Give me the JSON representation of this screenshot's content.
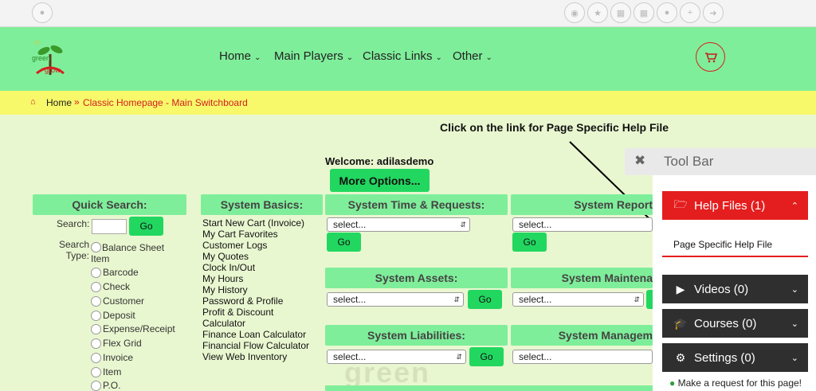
{
  "topbar": {
    "left_icon": "water-drop-icon",
    "right_icons": [
      "dashboard-icon",
      "star-icon",
      "building-icon",
      "calendar-icon",
      "user-icon",
      "add-user-icon",
      "sign-out-icon"
    ]
  },
  "nav": {
    "logo_text_1": "green",
    "logo_text_2": "grow",
    "items": [
      {
        "label": "Home"
      },
      {
        "label": "Main Players"
      },
      {
        "label": "Classic Links"
      },
      {
        "label": "Other"
      }
    ],
    "cart_icon": "shopping-cart-icon"
  },
  "breadcrumb": {
    "home": "Home",
    "separator": "»",
    "current": "Classic Homepage - Main Switchboard"
  },
  "help_caption": "Click on the link for Page Specific Help File",
  "welcome": "Welcome: adilasdemo",
  "more_options": "More Options...",
  "quick_search": {
    "title": "Quick Search:",
    "search_label": "Search:",
    "search_value": "",
    "go": "Go",
    "type_label": "Search Type:",
    "types": [
      "Balance Sheet Item",
      "Barcode",
      "Check",
      "Customer",
      "Deposit",
      "Expense/Receipt",
      "Flex Grid",
      "Invoice",
      "Item",
      "P.O."
    ]
  },
  "system_basics": {
    "title": "System Basics:",
    "links": [
      "Start New Cart (Invoice)",
      "My Cart Favorites",
      "Customer Logs",
      "My Quotes",
      "Clock In/Out",
      "My Hours",
      "My History",
      "Password & Profile",
      "Profit & Discount",
      "Calculator",
      "Finance Loan Calculator",
      "Financial Flow Calculator",
      "View Web Inventory"
    ]
  },
  "sections": {
    "time": {
      "title": "System Time & Requests:",
      "select": "select...",
      "go": "Go"
    },
    "reports": {
      "title": "System Report",
      "select": "select...",
      "go": "Go"
    },
    "assets": {
      "title": "System Assets:",
      "select": "select...",
      "go": "Go"
    },
    "maintenance": {
      "title": "System Maintena",
      "select": "select...",
      "go": "Go"
    },
    "liabilities": {
      "title": "System Liabilities:",
      "select": "select...",
      "go": "Go"
    },
    "management": {
      "title": "System Managem",
      "select": "select..."
    }
  },
  "toolbar": {
    "title": "Tool Bar",
    "help_files": "Help Files (1)",
    "page_help": "Page Specific Help File",
    "videos": "Videos (0)",
    "courses": "Courses (0)",
    "settings": "Settings (0)",
    "request": "Make a request for this page!"
  },
  "colors": {
    "nav_green": "#7fee9a",
    "button_green": "#22d760",
    "crumb_yellow": "#f7f86a",
    "accent_red": "#e41e1e",
    "dark_panel": "#2f2f2f"
  }
}
